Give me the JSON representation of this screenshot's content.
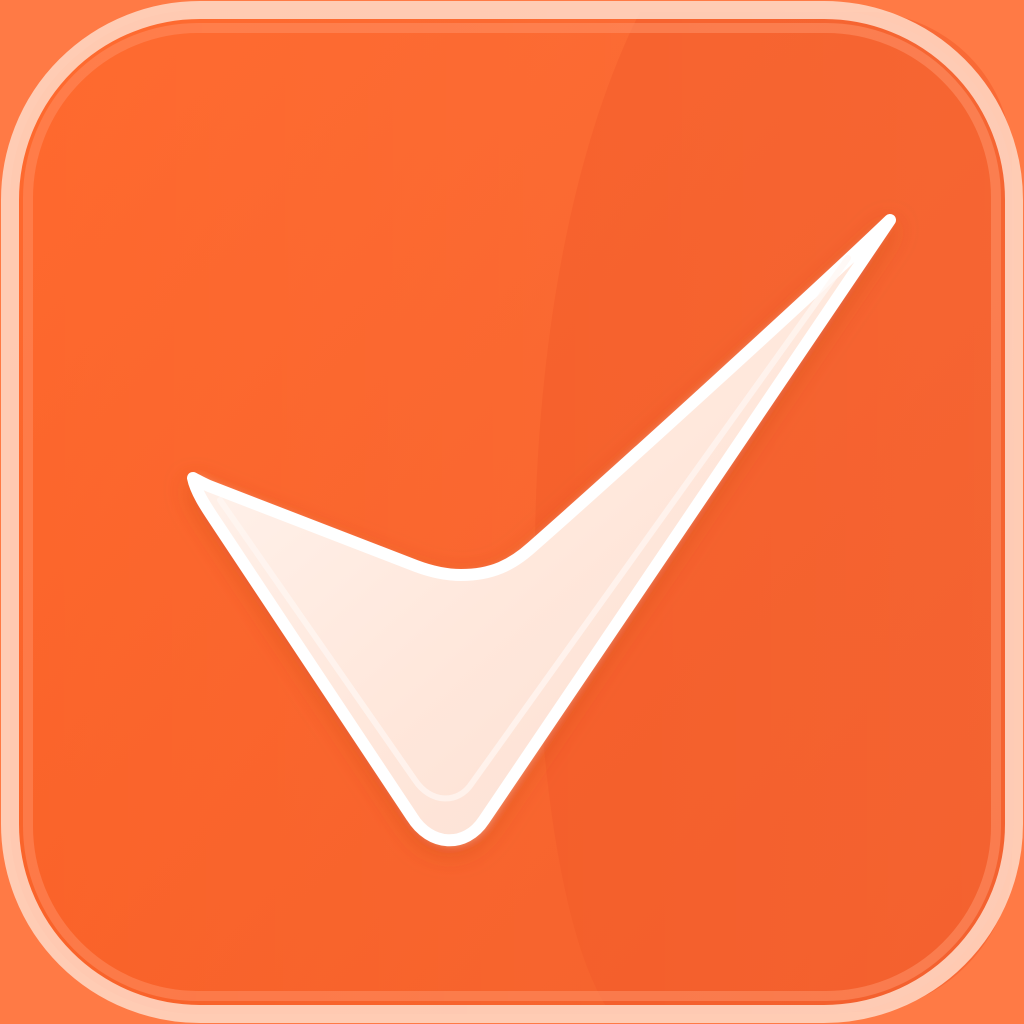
{
  "icon": {
    "name": "checkmark-app-icon",
    "symbol": "checkmark-icon",
    "colors": {
      "background": "#fd6227",
      "background_shadow": "#f2531f",
      "rim_highlight": "#ffd0b8",
      "checkmark_fill": "#fff1e9",
      "checkmark_stroke": "#ffffff"
    }
  }
}
